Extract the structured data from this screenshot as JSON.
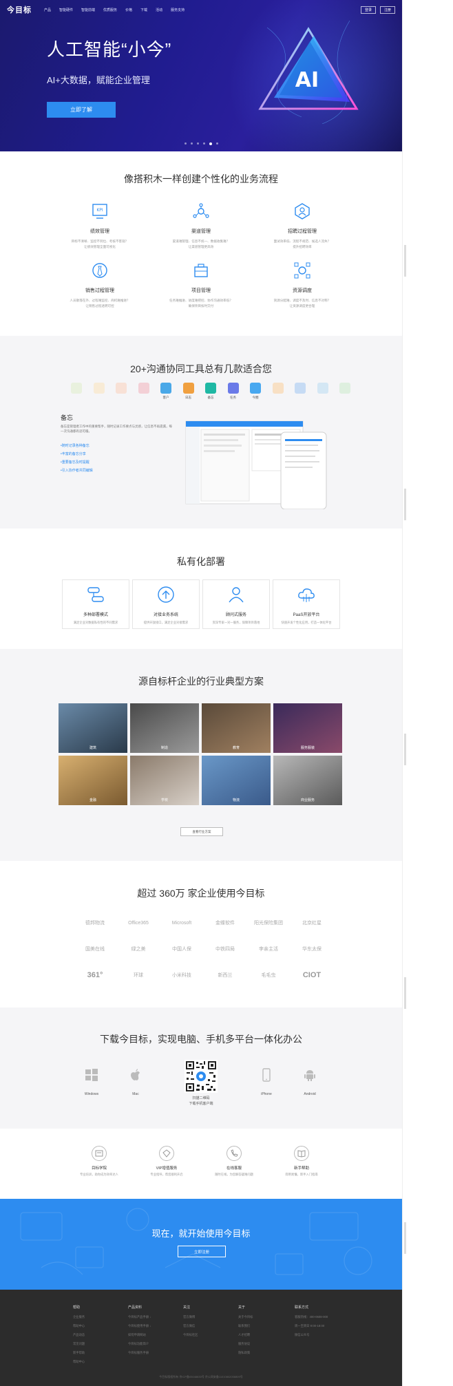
{
  "nav": {
    "logo": "今目标",
    "items": [
      "产品",
      "智能硬件",
      "智能前端",
      "优质服务",
      "价格",
      "下载",
      "活动",
      "服务支持"
    ],
    "login": "登录",
    "register": "注册"
  },
  "hero": {
    "title": "人工智能“小今”",
    "subtitle": "AI+大数据，赋能企业管理",
    "cta": "立即了解",
    "badge": "AI"
  },
  "features": {
    "title": "像搭积木一样创建个性化的业务流程",
    "items": [
      {
        "name": "绩效管理",
        "desc1": "目标不清晰、监控不到位、考核不客观？",
        "desc2": "让绩效管理全面可视化"
      },
      {
        "name": "渠道管理",
        "desc1": "渠道难管理、信息不统一、数据收集难？",
        "desc2": "让渠道管理更高效"
      },
      {
        "name": "招聘过程管理",
        "desc1": "面试效率低、流程不规范、候选人流失？",
        "desc2": "提升招聘效率"
      },
      {
        "name": "销售过程管理",
        "desc1": "人员散落在外、过程难监控、商机难推进？",
        "desc2": "让销售过程透明可控"
      },
      {
        "name": "项目管理",
        "desc1": "任务难推进、进度难把控、协作沟通效率低？",
        "desc2": "确保项目按时交付"
      },
      {
        "name": "资源调度",
        "desc1": "资源分配难、调度不及时、信息不对称？",
        "desc2": "让资源调度更合理"
      }
    ]
  },
  "tools": {
    "title": "20+沟通协同工具总有几款适合您",
    "items": [
      {
        "label": "",
        "color": "#cde8a6",
        "faded": true
      },
      {
        "label": "",
        "color": "#ffd48a",
        "faded": true
      },
      {
        "label": "",
        "color": "#ffb48a",
        "faded": true
      },
      {
        "label": "",
        "color": "#f07a8c",
        "faded": true
      },
      {
        "label": "客户",
        "color": "#4aa8e8",
        "faded": false
      },
      {
        "label": "日志",
        "color": "#f0a040",
        "faded": false
      },
      {
        "label": "备忘",
        "color": "#1fb8a4",
        "faded": false
      },
      {
        "label": "任务",
        "color": "#6a7ae8",
        "faded": false
      },
      {
        "label": "今圈",
        "color": "#48a8f0",
        "faded": false
      },
      {
        "label": "",
        "color": "#ffb050",
        "faded": true
      },
      {
        "label": "",
        "color": "#5aa0f0",
        "faded": true
      },
      {
        "label": "",
        "color": "#88c8f0",
        "faded": true
      },
      {
        "label": "",
        "color": "#a8e0a8",
        "faded": true
      }
    ],
    "memo": {
      "title": "备忘",
      "desc": "备忘是管理者工作中的重要帮手，随时记录工作要点与灵感，让信息不再遗漏，每一次沟通都有迹可循。",
      "links": [
        "•随时记录各种备忘",
        "•丰富的备忘分享",
        "•重要备忘及时提醒",
        "•引入协作者共同编辑"
      ]
    }
  },
  "private": {
    "title": "私有化部署",
    "cards": [
      {
        "name": "多种部署模式",
        "desc": "满足企业对数据私有性的不同需求"
      },
      {
        "name": "对接业务系统",
        "desc": "提供开放接口，满足企业对接需求"
      },
      {
        "name": "顾问式服务",
        "desc": "资深专家一对一服务，保障项目落地"
      },
      {
        "name": "PaaS开放平台",
        "desc": "快速开发个性化应用，打造一体化平台"
      }
    ]
  },
  "industry": {
    "title": "源自标杆企业的行业典型方案",
    "items": [
      {
        "label": "建筑",
        "c1": "#6a8aa8",
        "c2": "#2a3a4a"
      },
      {
        "label": "制造",
        "c1": "#4a4a4a",
        "c2": "#9a9a9a"
      },
      {
        "label": "教育",
        "c1": "#5a4a3a",
        "c2": "#a08060"
      },
      {
        "label": "服务服装",
        "c1": "#3a2a5a",
        "c2": "#8a4a6a"
      },
      {
        "label": "金融",
        "c1": "#d8b070",
        "c2": "#7a5a30"
      },
      {
        "label": "学校",
        "c1": "#8a7a6a",
        "c2": "#d8d0c8"
      },
      {
        "label": "物流",
        "c1": "#6a98c8",
        "c2": "#3a5a8a"
      },
      {
        "label": "商业服务",
        "c1": "#b8b8b8",
        "c2": "#5a5a5a"
      }
    ],
    "more": "查看行业方案"
  },
  "clients": {
    "title": "超过 360万 家企业使用今目标",
    "names": [
      "德邦物流",
      "Office365",
      "Microsoft",
      "金蝶软件",
      "阳光保险集团",
      "北京红星",
      "国美在线",
      "绿之美",
      "中国人保",
      "中铁四局",
      "李亲主活",
      "华东太保",
      "361°",
      "环球",
      "小米科技",
      "新西兰",
      "毛毛虫",
      "CIOT"
    ]
  },
  "download": {
    "title": "下载今目标，实现电脑、手机多平台一体化办公",
    "windows": "Windows",
    "mac": "Mac",
    "qr_line1": "扫描二维码",
    "qr_line2": "下载手机客户端",
    "iphone": "iPhone",
    "android": "Android"
  },
  "support": {
    "items": [
      {
        "name": "目标学院",
        "desc": "专业培训，助你成为效率达人"
      },
      {
        "name": "VIP增值服务",
        "desc": "专业指导，帮您顺利开启"
      },
      {
        "name": "在线客服",
        "desc": "随时在线，为您解答疑难问题"
      },
      {
        "name": "新手帮助",
        "desc": "简明易懂，新手入门指南"
      }
    ]
  },
  "cta": {
    "title": "现在，就开始使用今目标",
    "button": "立即注册"
  },
  "footer": {
    "cols": [
      {
        "head": "帮助",
        "links": [
          "企业服务",
          "帮助中心",
          "产品动态",
          "常见问题",
          "新手帮助",
          "帮助中心"
        ]
      },
      {
        "head": "产品资料",
        "links": [
          "今目标产品手册 ↓",
          "今目标使用手册 ↓",
          "如何申请网站",
          "今目标功能简介",
          "今目标服务手册"
        ]
      },
      {
        "head": "关注",
        "links": [
          "官方微博",
          "官方微信",
          "今目标社区"
        ]
      },
      {
        "head": "关于",
        "links": [
          "关于今目标",
          "联系我们",
          "人才招聘",
          "服务协议",
          "隐私政策"
        ]
      },
      {
        "head": "联系方式",
        "links": [
          "客服热线：400-0608-000",
          "周一至周日 9:00-18:00",
          "微信公众号"
        ]
      }
    ],
    "copyright": "今目标版权所有 京ICP备05048830号 京公网安备11010802008809号"
  }
}
